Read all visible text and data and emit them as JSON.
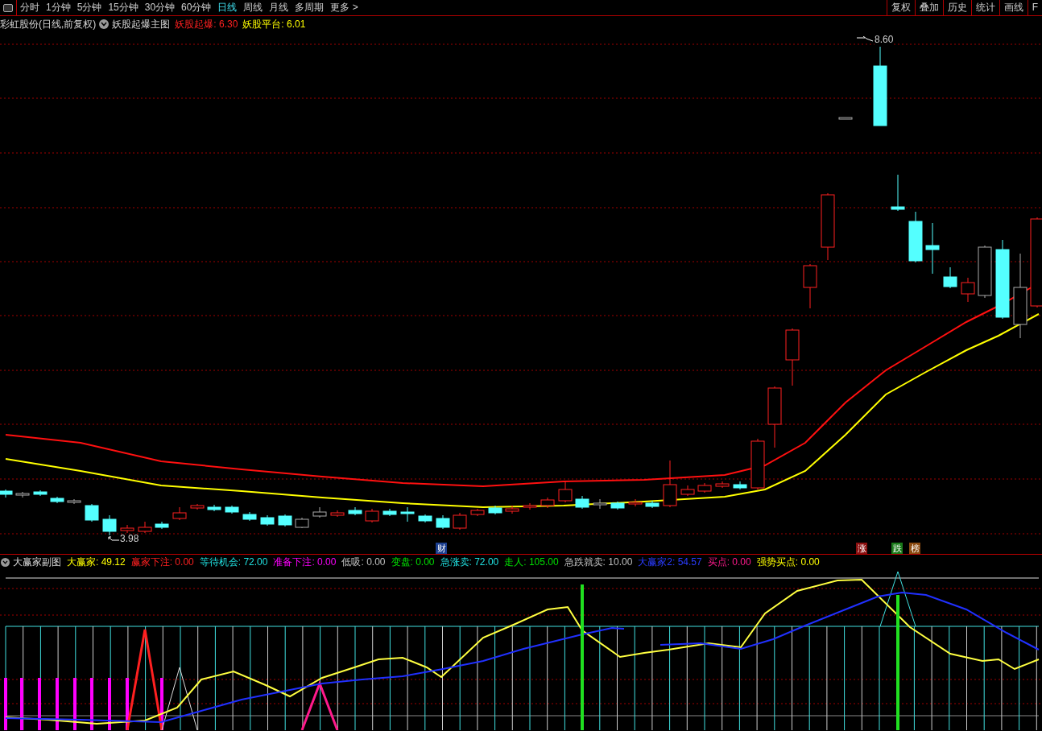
{
  "toolbar": {
    "periods": [
      {
        "label": "分时",
        "selected": false
      },
      {
        "label": "1分钟",
        "selected": false
      },
      {
        "label": "5分钟",
        "selected": false
      },
      {
        "label": "15分钟",
        "selected": false
      },
      {
        "label": "30分钟",
        "selected": false
      },
      {
        "label": "60分钟",
        "selected": false
      },
      {
        "label": "日线",
        "selected": true
      },
      {
        "label": "周线",
        "selected": false
      },
      {
        "label": "月线",
        "selected": false
      },
      {
        "label": "多周期",
        "selected": false
      }
    ],
    "more": "更多",
    "more_arrow": ">",
    "actions": [
      "复权",
      "叠加",
      "历史",
      "统计",
      "画线",
      "F"
    ]
  },
  "main_legend": {
    "security": "彩虹股份(日线,前复权)",
    "indicator": "妖股起爆主图",
    "values": [
      {
        "text": "妖股起爆: 6.30",
        "color": "#ff2020"
      },
      {
        "text": "妖股平台: 6.01",
        "color": "#ffff00"
      }
    ]
  },
  "main_chart": {
    "high_label": "8.60",
    "low_label": "3.98",
    "markers": [
      {
        "text": "财",
        "color": "#1c3f8f"
      },
      {
        "text": "涨",
        "color": "#8b1010"
      },
      {
        "text": "跌",
        "color": "#1a7a1a"
      },
      {
        "text": "榜",
        "color": "#8b4a10"
      }
    ]
  },
  "sub_legend": {
    "indicator": "大赢家副图",
    "values": [
      {
        "text": "大赢家: 49.12",
        "color": "#ffff00"
      },
      {
        "text": "赢家下注: 0.00",
        "color": "#ff2020"
      },
      {
        "text": "等待机会: 72.00",
        "color": "#20e0e0"
      },
      {
        "text": "准备下注: 0.00",
        "color": "#ff00ff"
      },
      {
        "text": "低吸: 0.00",
        "color": "#c0c0c0"
      },
      {
        "text": "变盘: 0.00",
        "color": "#00e000"
      },
      {
        "text": "急涨卖: 72.00",
        "color": "#20e0e0"
      },
      {
        "text": "走人: 105.00",
        "color": "#00e000"
      },
      {
        "text": "急跌就卖: 10.00",
        "color": "#c0c0c0"
      },
      {
        "text": "大赢家2: 54.57",
        "color": "#2a3cff"
      },
      {
        "text": "买点: 0.00",
        "color": "#ff1a8c"
      },
      {
        "text": "强势买点: 0.00",
        "color": "#ffff00"
      }
    ]
  }
}
